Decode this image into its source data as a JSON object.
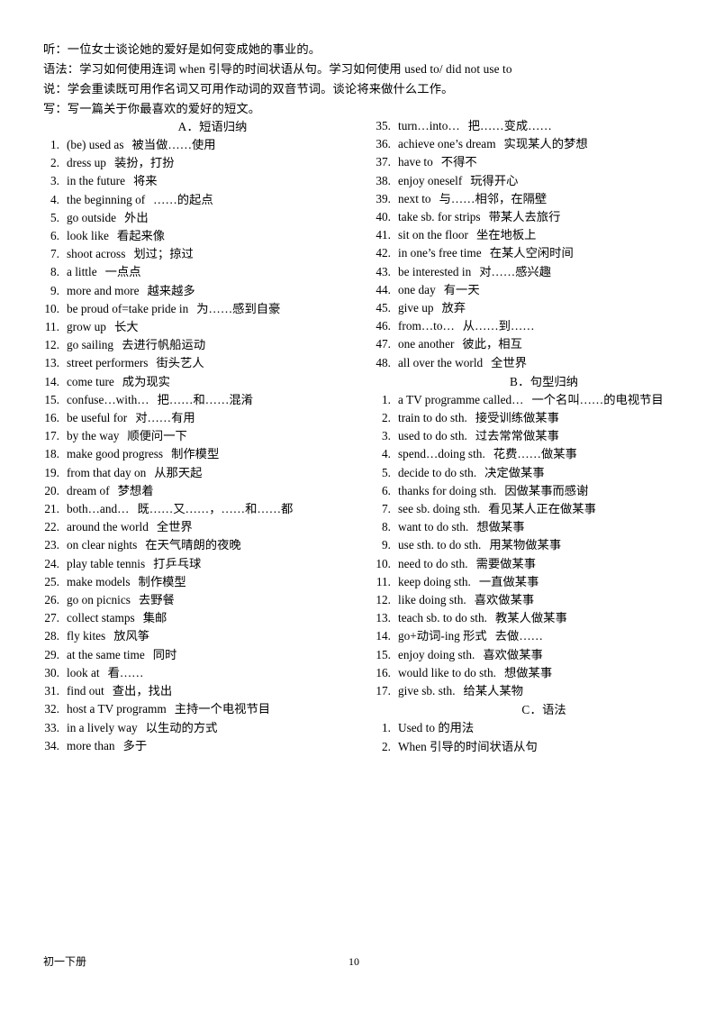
{
  "intro": {
    "lines": [
      "听：一位女士谈论她的爱好是如何变成她的事业的。",
      "语法：学习如何使用连词 when 引导的时间状语从句。学习如何使用 used to/ did not use to",
      "说：学会重读既可用作名词又可用作动词的双音节词。谈论将来做什么工作。",
      "写：写一篇关于你最喜欢的爱好的短文。"
    ]
  },
  "sections": {
    "a": {
      "label": "A．",
      "title": "短语归纳"
    },
    "b": {
      "label": "B．",
      "title": "句型归纳"
    },
    "c": {
      "label": "C．",
      "title": "语法"
    }
  },
  "phrases_left": [
    {
      "num": "1.",
      "en": "(be) used as",
      "cn": "被当做……使用"
    },
    {
      "num": "2.",
      "en": "dress up",
      "cn": "装扮，打扮"
    },
    {
      "num": "3.",
      "en": "in the future",
      "cn": "将来"
    },
    {
      "num": "4.",
      "en": "the beginning of",
      "cn": "……的起点"
    },
    {
      "num": "5.",
      "en": "go outside",
      "cn": "外出"
    },
    {
      "num": "6.",
      "en": "look like",
      "cn": "看起来像"
    },
    {
      "num": "7.",
      "en": "shoot across",
      "cn": "划过；掠过"
    },
    {
      "num": "8.",
      "en": "a little",
      "cn": "一点点"
    },
    {
      "num": "9.",
      "en": "more and more",
      "cn": "越来越多"
    },
    {
      "num": "10.",
      "en": "be proud of=take pride in",
      "cn": "为……感到自豪"
    },
    {
      "num": "11.",
      "en": "grow up",
      "cn": "长大"
    },
    {
      "num": "12.",
      "en": "go sailing",
      "cn": "去进行帆船运动"
    },
    {
      "num": "13.",
      "en": "street performers",
      "cn": "街头艺人"
    },
    {
      "num": "14.",
      "en": "come ture",
      "cn": "成为现实"
    },
    {
      "num": "15.",
      "en": "confuse…with…",
      "cn": "把……和……混淆"
    },
    {
      "num": "16.",
      "en": "be useful for",
      "cn": "对……有用"
    },
    {
      "num": "17.",
      "en": "by the way",
      "cn": "顺便问一下"
    },
    {
      "num": "18.",
      "en": "make good progress",
      "cn": "制作模型"
    },
    {
      "num": "19.",
      "en": "from that day on",
      "cn": "从那天起"
    },
    {
      "num": "20.",
      "en": "dream of",
      "cn": "梦想着"
    },
    {
      "num": "21.",
      "en": "both…and…",
      "cn": "既……又……，……和……都"
    },
    {
      "num": "22.",
      "en": "around the world",
      "cn": "全世界"
    },
    {
      "num": "23.",
      "en": "on clear nights",
      "cn": "在天气晴朗的夜晚"
    },
    {
      "num": "24.",
      "en": "play table tennis",
      "cn": "打乒乓球"
    },
    {
      "num": "25.",
      "en": "make models",
      "cn": "制作模型"
    },
    {
      "num": "26.",
      "en": "go on picnics",
      "cn": "去野餐"
    },
    {
      "num": "27.",
      "en": "collect stamps",
      "cn": "集邮"
    },
    {
      "num": "28.",
      "en": "fly kites",
      "cn": "放风筝"
    },
    {
      "num": "29.",
      "en": "at the same time",
      "cn": "同时"
    },
    {
      "num": "30.",
      "en": "look at",
      "cn": "看……"
    },
    {
      "num": "31.",
      "en": "find out",
      "cn": "查出，找出"
    },
    {
      "num": "32.",
      "en": "host a TV programm",
      "cn": "主持一个电视节目"
    },
    {
      "num": "33.",
      "en": "in a lively way",
      "cn": "以生动的方式"
    },
    {
      "num": "34.",
      "en": "more than",
      "cn": "多于"
    }
  ],
  "phrases_right": [
    {
      "num": "35.",
      "en": "turn…into…",
      "cn": "把……变成……"
    },
    {
      "num": "36.",
      "en": "achieve one’s dream",
      "cn": "实现某人的梦想"
    },
    {
      "num": "37.",
      "en": "have to",
      "cn": "不得不"
    },
    {
      "num": "38.",
      "en": "enjoy oneself",
      "cn": "玩得开心"
    },
    {
      "num": "39.",
      "en": "next to",
      "cn": "与……相邻，在隔壁"
    },
    {
      "num": "40.",
      "en": "take sb. for strips",
      "cn": "带某人去旅行"
    },
    {
      "num": "41.",
      "en": "sit on the floor",
      "cn": "坐在地板上"
    },
    {
      "num": "42.",
      "en": "in one’s free time",
      "cn": "在某人空闲时间"
    },
    {
      "num": "43.",
      "en": "be interested in",
      "cn": "对……感兴趣"
    },
    {
      "num": "44.",
      "en": "one day",
      "cn": "有一天"
    },
    {
      "num": "45.",
      "en": "give up",
      "cn": "放弃"
    },
    {
      "num": "46.",
      "en": "from…to…",
      "cn": "从……到……"
    },
    {
      "num": "47.",
      "en": "one another",
      "cn": "彼此，相互"
    },
    {
      "num": "48.",
      "en": "all over the world",
      "cn": "全世界"
    }
  ],
  "sentences": [
    {
      "num": "1.",
      "en": "a TV programme called…",
      "cn": "一个名叫……的电视节目"
    },
    {
      "num": "2.",
      "en": "train to do sth.",
      "cn": "接受训练做某事"
    },
    {
      "num": "3.",
      "en": "used to do sth.",
      "cn": "过去常常做某事"
    },
    {
      "num": "4.",
      "en": "spend…doing sth.",
      "cn": "花费……做某事"
    },
    {
      "num": "5.",
      "en": "decide to do sth.",
      "cn": "决定做某事"
    },
    {
      "num": "6.",
      "en": "thanks for doing sth.",
      "cn": "因做某事而感谢"
    },
    {
      "num": "7.",
      "en": "see sb. doing sth.",
      "cn": "看见某人正在做某事"
    },
    {
      "num": "8.",
      "en": "want to do sth.",
      "cn": "想做某事"
    },
    {
      "num": "9.",
      "en": "use sth. to do sth.",
      "cn": "用某物做某事"
    },
    {
      "num": "10.",
      "en": "need to do sth.",
      "cn": "需要做某事"
    },
    {
      "num": "11.",
      "en": "keep doing sth.",
      "cn": "一直做某事"
    },
    {
      "num": "12.",
      "en": "like doing sth.",
      "cn": "喜欢做某事"
    },
    {
      "num": "13.",
      "en": "teach sb. to do sth.",
      "cn": "教某人做某事"
    },
    {
      "num": "14.",
      "en": "go+动词-ing 形式",
      "cn": "去做……"
    },
    {
      "num": "15.",
      "en": "enjoy doing sth.",
      "cn": "喜欢做某事"
    },
    {
      "num": "16.",
      "en": "would like to do sth.",
      "cn": "想做某事"
    },
    {
      "num": "17.",
      "en": "give sb. sth.",
      "cn": "给某人某物"
    }
  ],
  "grammar": [
    {
      "num": "1.",
      "en": "Used to 的用法",
      "cn": ""
    },
    {
      "num": "2.",
      "en": "When 引导的时间状语从句",
      "cn": ""
    }
  ],
  "footer": {
    "book": "初一下册",
    "page": "10"
  }
}
